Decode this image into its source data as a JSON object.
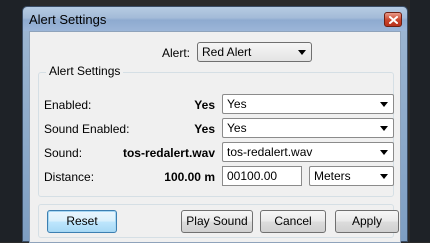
{
  "window": {
    "title": "Alert Settings"
  },
  "alert": {
    "label": "Alert:",
    "selected": "Red Alert"
  },
  "group": {
    "legend": "Alert Settings",
    "rows": [
      {
        "label": "Enabled:",
        "value": "Yes",
        "selected": "Yes"
      },
      {
        "label": "Sound Enabled:",
        "value": "Yes",
        "selected": "Yes"
      },
      {
        "label": "Sound:",
        "value": "tos-redalert.wav",
        "selected": "tos-redalert.wav"
      },
      {
        "label": "Distance:",
        "value": "100.00 m",
        "input": "00100.00",
        "unit": "Meters"
      }
    ]
  },
  "buttons": {
    "reset": "Reset",
    "play_sound": "Play Sound",
    "cancel": "Cancel",
    "apply": "Apply"
  }
}
